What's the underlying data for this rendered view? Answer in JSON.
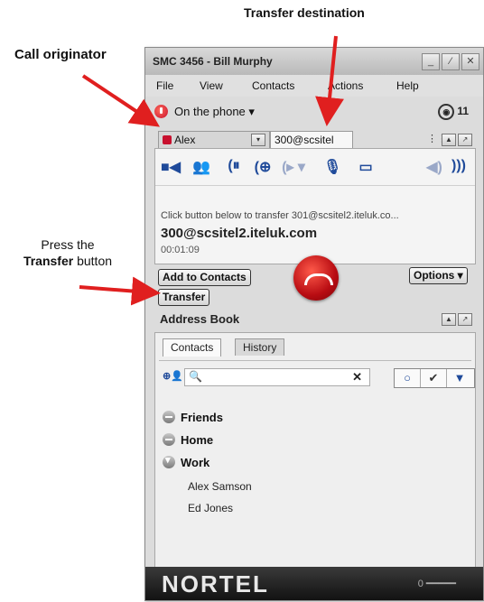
{
  "annotations": {
    "transfer_destination": "Transfer destination",
    "call_originator": "Call originator",
    "press_line1": "Press the",
    "press_bold": "Transfer",
    "press_rest": " button"
  },
  "window": {
    "title": "SMC 3456 - Bill Murphy",
    "menu": [
      "File",
      "View",
      "Contacts",
      "Actions",
      "Help"
    ]
  },
  "status": {
    "text": "On the phone ▾",
    "badge_count": "11"
  },
  "call_tabs": [
    {
      "label": "Alex"
    },
    {
      "label": "300@scsitel"
    }
  ],
  "call": {
    "transfer_prompt": "Click button below to transfer 301@scsitel2.iteluk.co...",
    "destination": "300@scsitel2.iteluk.com",
    "duration": "00:01:09"
  },
  "buttons": {
    "add_to_contacts": "Add to Contacts",
    "options": "Options ▾",
    "transfer": "Transfer"
  },
  "address_book": {
    "title": "Address Book",
    "tabs": [
      "Contacts",
      "History"
    ],
    "search_value": "",
    "groups": [
      {
        "name": "Friends",
        "expanded": false
      },
      {
        "name": "Home",
        "expanded": false
      },
      {
        "name": "Work",
        "expanded": true
      }
    ],
    "members": [
      "Alex Samson",
      "Ed Jones"
    ]
  },
  "footer": {
    "brand": "NORTEL",
    "volume": "0"
  },
  "colors": {
    "accent_blue": "#1f4a9a",
    "hangup_red": "#c8102e",
    "arrow_red": "#e01f1f"
  }
}
